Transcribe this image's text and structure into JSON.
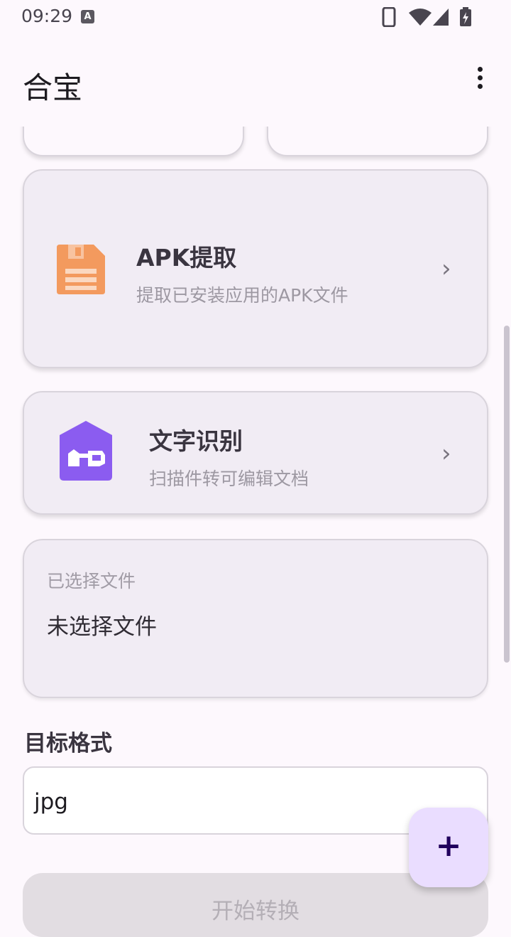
{
  "status_bar": {
    "time": "09:29",
    "notification_badge": "A"
  },
  "app_bar": {
    "title": "合宝",
    "menu_icon": "more-vert-icon"
  },
  "cards": [
    {
      "title": "APK提取",
      "subtitle": "提取已安装应用的APK文件",
      "icon": "save-disk-icon",
      "icon_color": "#f39a5e"
    },
    {
      "title": "文字识别",
      "subtitle": "扫描件转可编辑文档",
      "icon": "scan-house-icon",
      "icon_color": "#8b5cf0"
    }
  ],
  "file_section": {
    "label": "已选择文件",
    "value": "未选择文件"
  },
  "target_format": {
    "label": "目标格式",
    "value": "jpg"
  },
  "convert_button": {
    "label": "开始转换"
  },
  "fab": {
    "icon": "add-icon",
    "symbol": "+"
  },
  "colors": {
    "background": "#fdf8fd",
    "card": "#f1ecf4",
    "fab": "#eaddff"
  }
}
